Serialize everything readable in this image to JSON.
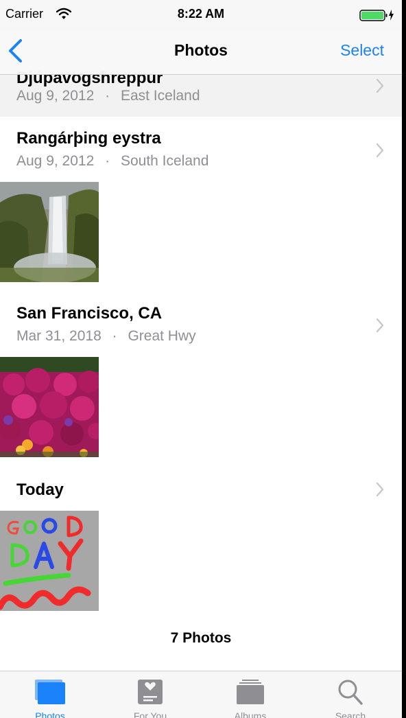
{
  "status_bar": {
    "carrier": "Carrier",
    "time": "8:22 AM"
  },
  "nav": {
    "back_icon": "chevron-left-icon",
    "title": "Photos",
    "select_label": "Select"
  },
  "moments": [
    {
      "title": "Djúpavogshreppur",
      "date": "Aug 9, 2012",
      "separator": "·",
      "location": "East Iceland",
      "has_photo": false
    },
    {
      "title": "Rangárþing eystra",
      "date": "Aug 9, 2012",
      "separator": "·",
      "location": "South Iceland",
      "photo": "waterfall"
    },
    {
      "title": "San Francisco, CA",
      "date": "Mar 31, 2018",
      "separator": "·",
      "location": "Great Hwy",
      "photo": "flowers"
    },
    {
      "title": "Today",
      "photo": "good-day-drawing"
    }
  ],
  "footer": {
    "count": "7 Photos"
  },
  "tab_bar": {
    "tabs": [
      {
        "label": "Photos",
        "icon": "photos-icon",
        "active": true
      },
      {
        "label": "For You",
        "icon": "for-you-icon",
        "active": false
      },
      {
        "label": "Albums",
        "icon": "albums-icon",
        "active": false
      },
      {
        "label": "Search",
        "icon": "search-icon",
        "active": false
      }
    ]
  },
  "colors": {
    "accent": "#1a82fb",
    "secondary_text": "#8e8e93"
  }
}
